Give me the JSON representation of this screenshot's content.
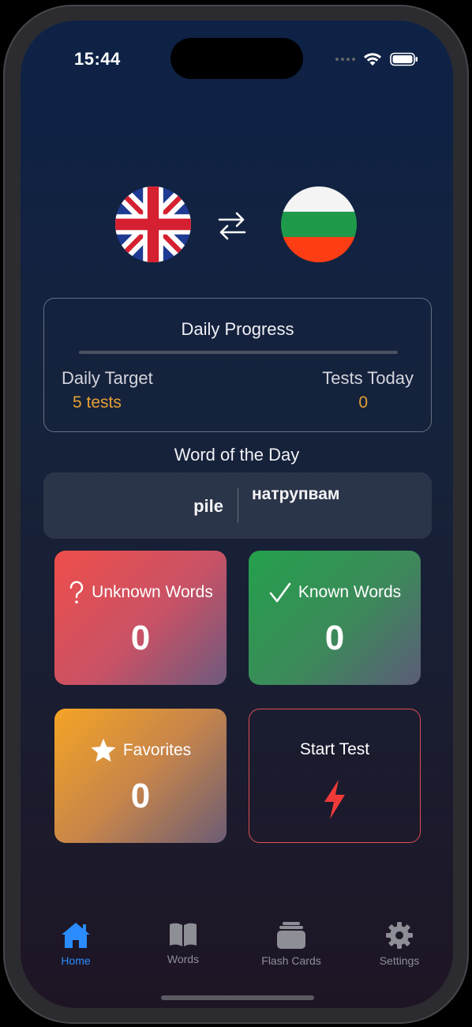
{
  "status_bar": {
    "time": "15:44"
  },
  "languages": {
    "source_flag": "uk-flag",
    "target_flag": "bulgaria-flag",
    "swap_icon": "swap-arrows-icon"
  },
  "daily_progress": {
    "title": "Daily Progress",
    "progress": 0,
    "daily_target_label": "Daily Target",
    "daily_target_value": "5 tests",
    "tests_today_label": "Tests Today",
    "tests_today_value": "0"
  },
  "word_of_the_day": {
    "title": "Word of the Day",
    "english": "pile",
    "bulgarian": "натрупвам"
  },
  "tiles": {
    "unknown": {
      "label": "Unknown Words",
      "count": "0",
      "icon": "question-mark-icon"
    },
    "known": {
      "label": "Known Words",
      "count": "0",
      "icon": "checkmark-icon"
    },
    "favorites": {
      "label": "Favorites",
      "count": "0",
      "icon": "star-icon"
    },
    "start_test": {
      "label": "Start Test",
      "icon": "lightning-bolt-icon"
    }
  },
  "tabbar": {
    "items": [
      {
        "label": "Home",
        "icon": "house-icon",
        "active": true
      },
      {
        "label": "Words",
        "icon": "book-icon",
        "active": false
      },
      {
        "label": "Flash Cards",
        "icon": "card-stack-icon",
        "active": false
      },
      {
        "label": "Settings",
        "icon": "gear-icon",
        "active": false
      }
    ]
  },
  "colors": {
    "accent": "#e5a033",
    "tab_active": "#2a8cff",
    "tab_inactive": "#8e8e96",
    "start_test_border": "#e05050"
  }
}
